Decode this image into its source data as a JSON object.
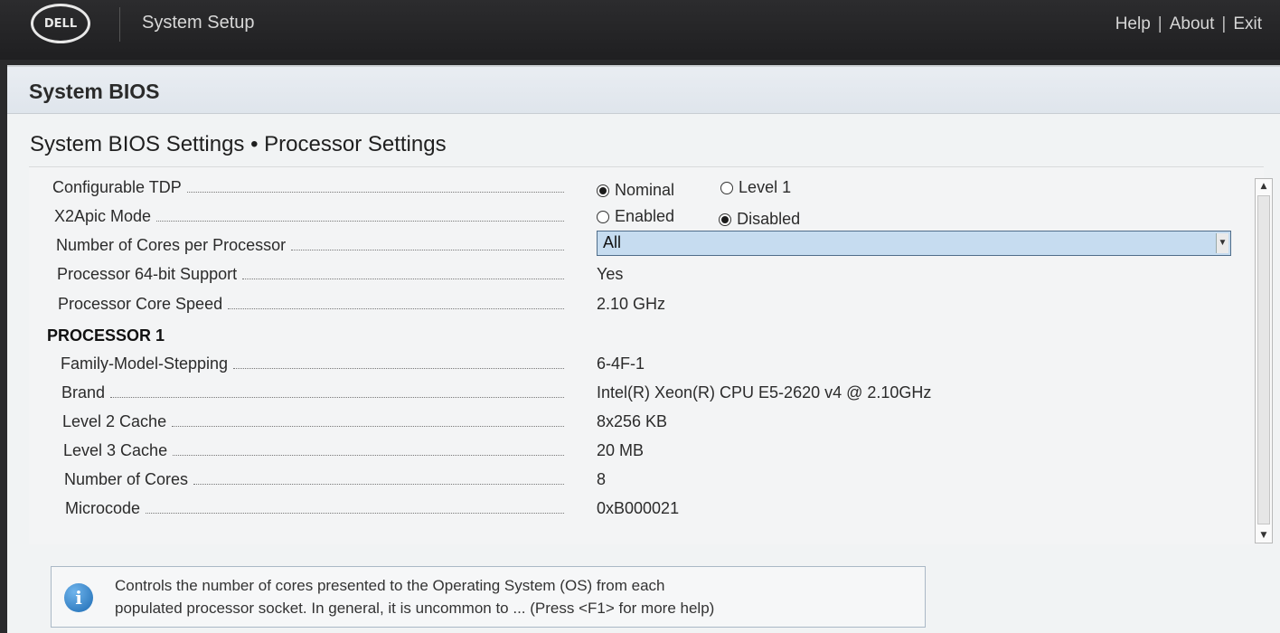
{
  "header": {
    "logo_text": "DELL",
    "app_title": "System Setup",
    "links": [
      "Help",
      "About",
      "Exit"
    ],
    "separator": "|"
  },
  "panel": {
    "title": "System BIOS",
    "breadcrumb": "System BIOS Settings • Processor Settings"
  },
  "settings": {
    "configurable_tdp": {
      "label": "Configurable TDP",
      "options": [
        "Nominal",
        "Level 1"
      ],
      "selected": "Nominal"
    },
    "x2apic_mode": {
      "label": "X2Apic Mode",
      "options": [
        "Enabled",
        "Disabled"
      ],
      "selected": "Disabled"
    },
    "cores_per_processor": {
      "label": "Number of Cores per Processor",
      "value": "All"
    },
    "processor_64bit": {
      "label": "Processor 64-bit Support",
      "value": "Yes"
    },
    "core_speed": {
      "label": "Processor Core Speed",
      "value": "2.10 GHz"
    }
  },
  "processor1": {
    "heading": "PROCESSOR 1",
    "rows": [
      {
        "label": "Family-Model-Stepping",
        "value": "6-4F-1"
      },
      {
        "label": "Brand",
        "value": "Intel(R) Xeon(R) CPU E5-2620 v4 @ 2.10GHz"
      },
      {
        "label": "Level 2 Cache",
        "value": "8x256 KB"
      },
      {
        "label": "Level 3 Cache",
        "value": "20 MB"
      },
      {
        "label": "Number of Cores",
        "value": "8"
      },
      {
        "label": "Microcode",
        "value": "0xB000021"
      }
    ]
  },
  "help": {
    "icon": "info-icon",
    "line1": "Controls the number of cores presented to the Operating System (OS) from each",
    "line2": "populated processor socket. In general, it is uncommon to ... (Press <F1> for more help)"
  }
}
